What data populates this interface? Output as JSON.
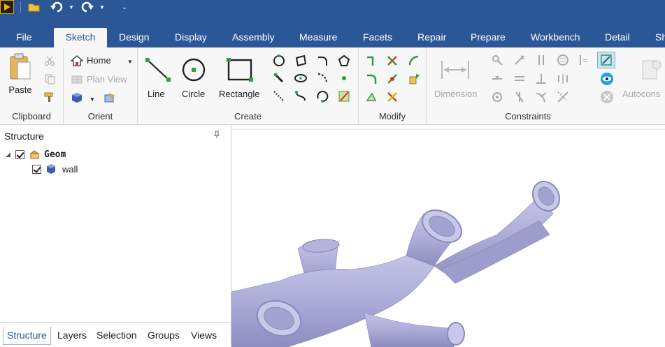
{
  "quick_access": {
    "app_icon": "application-logo-icon",
    "open_icon": "folder-open-icon",
    "undo_icon": "undo-icon",
    "redo_icon": "redo-icon",
    "customize_icon": "customize-toolbar-icon"
  },
  "tabs": [
    {
      "label": "File"
    },
    {
      "label": "Sketch",
      "active": true
    },
    {
      "label": "Design"
    },
    {
      "label": "Display"
    },
    {
      "label": "Assembly"
    },
    {
      "label": "Measure"
    },
    {
      "label": "Facets"
    },
    {
      "label": "Repair"
    },
    {
      "label": "Prepare"
    },
    {
      "label": "Workbench"
    },
    {
      "label": "Detail"
    },
    {
      "label": "Sh"
    }
  ],
  "ribbon": {
    "clipboard": {
      "group_label": "Clipboard",
      "paste_label": "Paste"
    },
    "orient": {
      "group_label": "Orient",
      "home_label": "Home",
      "plan_view_label": "Plan View"
    },
    "create": {
      "group_label": "Create",
      "line_label": "Line",
      "circle_label": "Circle",
      "rectangle_label": "Rectangle"
    },
    "modify": {
      "group_label": "Modify"
    },
    "constraints": {
      "group_label": "Constraints",
      "dimension_label": "Dimension",
      "autoconstrain_label": "Autocons"
    }
  },
  "structure_panel": {
    "title": "Structure",
    "pin_icon": "pin-icon",
    "tree": [
      {
        "label": "Geom",
        "checked": true,
        "expanded": true,
        "icon": "geometry-root-icon"
      },
      {
        "label": "wall",
        "checked": true,
        "icon": "solid-body-icon"
      }
    ],
    "bottom_tabs": [
      {
        "label": "Structure",
        "active": true
      },
      {
        "label": "Layers"
      },
      {
        "label": "Selection"
      },
      {
        "label": "Groups"
      },
      {
        "label": "Views"
      }
    ]
  },
  "viewport": {
    "model_color": "#a9a9d6",
    "model_name": "wall"
  },
  "colors": {
    "title_bar": "#2b5797",
    "ribbon_bg": "#f7f7f7",
    "sketch_green": "#2e9b4a"
  }
}
